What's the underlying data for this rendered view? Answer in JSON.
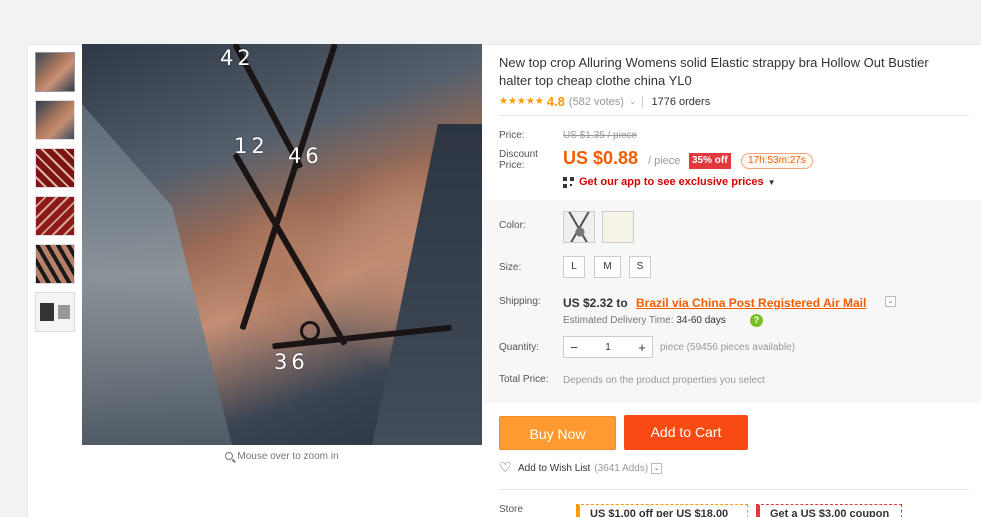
{
  "image_overlay_numbers": [
    "42",
    "12",
    "46",
    "36"
  ],
  "zoom_hint": "Mouse over to zoom in",
  "product": {
    "title": "New top crop Alluring Womens solid Elastic strappy bra Hollow Out Bustier halter top cheap clothe china YL0",
    "rating_value": "4.8",
    "votes": "(582 votes)",
    "orders": "1776 orders"
  },
  "price": {
    "price_label": "Price:",
    "old_price": "US $1.35 / piece",
    "discount_label_1": "Discount",
    "discount_label_2": "Price:",
    "discount_price": "US $0.88",
    "per_piece": "/ piece",
    "off_badge": "35% off",
    "timer": "17h:53m:27s",
    "app_promo": "Get our app to see exclusive prices"
  },
  "options": {
    "color_label": "Color:",
    "size_label": "Size:",
    "sizes": [
      "L",
      "M",
      "S"
    ],
    "shipping_label": "Shipping:",
    "shipping_price": "US $2.32 to",
    "shipping_method": "Brazil via China Post Registered Air Mail",
    "delivery_label": "Estimated Delivery Time:",
    "delivery_days": "34-60 days",
    "quantity_label": "Quantity:",
    "quantity_value": "1",
    "quantity_available": "piece (59456 pieces available)",
    "total_label": "Total Price:",
    "total_note": "Depends on the product properties you select"
  },
  "actions": {
    "buy_now": "Buy Now",
    "add_to_cart": "Add to Cart",
    "wishlist": "Add to Wish List",
    "wishlist_count": "(3641 Adds)"
  },
  "store": {
    "label": "Store",
    "coupon_1": "US $1.00 off per US $18.00",
    "coupon_2": "Get a US $3.00 coupon"
  },
  "colors": {
    "accent": "#f45c00",
    "buy_now": "#ff9a33",
    "add_to_cart": "#fa4a14",
    "badge": "#e4393c",
    "promo": "#d60000",
    "stars": "#ff9a00"
  }
}
